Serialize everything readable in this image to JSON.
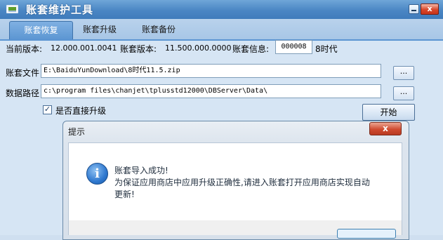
{
  "window": {
    "title": "账套维护工具",
    "minimize_label": "",
    "close_label": "x"
  },
  "tabs": [
    {
      "label": "账套恢复",
      "active": true
    },
    {
      "label": "账套升级",
      "active": false
    },
    {
      "label": "账套备份",
      "active": false
    }
  ],
  "version_row": {
    "current_version_label": "当前版本:",
    "current_version_value": "12.000.001.0041",
    "account_version_label": "账套版本:",
    "account_version_value": "11.500.000.0000",
    "account_info_label": "账套信息:",
    "account_info_value": "000008",
    "account_info_suffix": "8时代"
  },
  "file_row": {
    "label": "账套文件",
    "value": "E:\\BaiduYunDownload\\8时代11.5.zip",
    "browse_label": "..."
  },
  "path_row": {
    "label": "数据路径",
    "value": "c:\\program files\\chanjet\\tplusstd12000\\DBServer\\Data\\",
    "browse_label": "..."
  },
  "direct_upgrade": {
    "label": "是否直接升级",
    "checked": true,
    "check_glyph": "✓"
  },
  "start_button": {
    "label": "开始"
  },
  "dialog": {
    "title": "提示",
    "close_label": "x",
    "icon": "info-icon",
    "icon_glyph": "i",
    "message_lines": [
      "账套导入成功!",
      "为保证应用商店中应用升级正确性,请进入账套打开应用商店实现自动",
      "更新!"
    ]
  },
  "colors": {
    "title_bar": "#4a86c4",
    "active_tab": "#5b95d2",
    "window_bg": "#d6e5f4",
    "close_red": "#cf4b30"
  }
}
